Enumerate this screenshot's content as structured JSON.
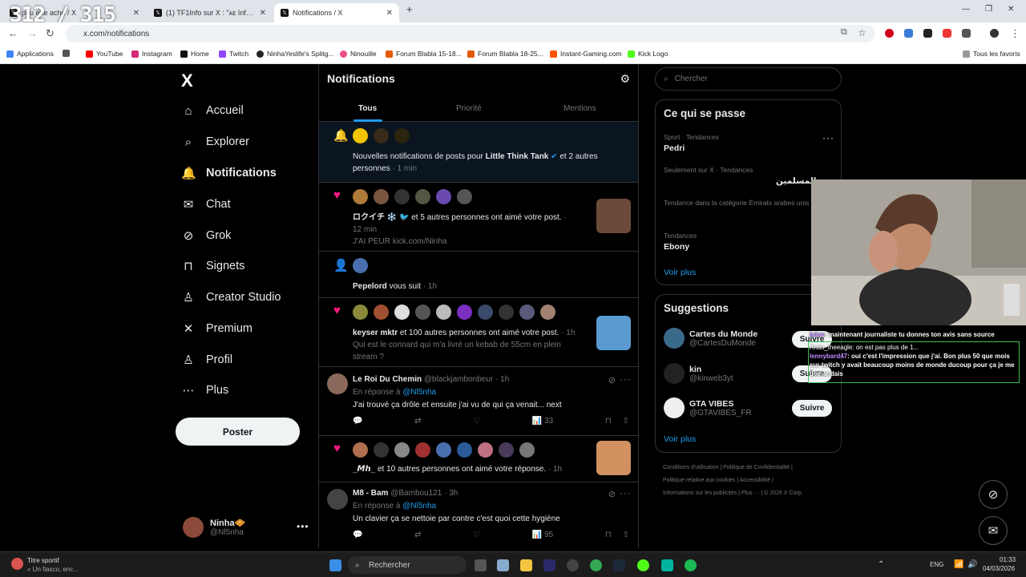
{
  "browser": {
    "tabs": [
      {
        "title": "pou     ette   ache / X"
      },
      {
        "title": "(1) TF1Info sur X : \"ᴀᴇ Influence..."
      },
      {
        "title": "Notifications / X"
      }
    ],
    "new_tab": "+",
    "url": "x.com/notifications",
    "bookmarks": [
      "Applications",
      "YouTube",
      "Instagram",
      "Home",
      "Twitch",
      "NinhaYeslife's Splitg...",
      "Ninouille",
      "Forum Blabla 15-18...",
      "Forum Blabla 18-25...",
      "Instant-Gaming.com",
      "Kick Logo"
    ],
    "all_bookmarks": "Tous les favoris"
  },
  "overlay_counter": "312 / 315",
  "sidebar": {
    "logo": "X",
    "items": [
      {
        "label": "Accueil",
        "icon": "home-icon",
        "glyph": "⌂"
      },
      {
        "label": "Explorer",
        "icon": "search-icon",
        "glyph": "⌕"
      },
      {
        "label": "Notifications",
        "icon": "bell-icon",
        "glyph": "🔔"
      },
      {
        "label": "Chat",
        "icon": "mail-icon",
        "glyph": "✉"
      },
      {
        "label": "Grok",
        "icon": "grok-icon",
        "glyph": "⊘"
      },
      {
        "label": "Signets",
        "icon": "bookmark-icon",
        "glyph": "⊓"
      },
      {
        "label": "Creator Studio",
        "icon": "flask-icon",
        "glyph": "♙"
      },
      {
        "label": "Premium",
        "icon": "x-icon",
        "glyph": "✕"
      },
      {
        "label": "Profil",
        "icon": "person-icon",
        "glyph": "♙"
      },
      {
        "label": "Plus",
        "icon": "more-circle-icon",
        "glyph": "⋯"
      }
    ],
    "post_button": "Poster",
    "user": {
      "name": "Ninha🧇",
      "handle": "@Nl5nha"
    }
  },
  "main": {
    "title": "Notifications",
    "tabs": [
      "Tous",
      "Priorité",
      "Mentions"
    ],
    "n1": {
      "pre": "Nouvelles notifications de posts pour ",
      "name": "Little Think Tank",
      "post": " et 2 autres",
      "line2": "personnes",
      "time": " · 1 min"
    },
    "n2": {
      "name": "ロクイチ ❄️ 🐦",
      "text": " et 5 autres personnes ont aimé votre post.",
      "dot": " ·",
      "time": "12 min",
      "quote": "J'AI PEUR kick.com/Ninha"
    },
    "n3": {
      "name": "Pepelord",
      "text": " vous suit",
      "time": " · 1h"
    },
    "n4": {
      "name": "keyser mktr",
      "text": " et 100 autres personnes ont aimé votre post.",
      "time": " · 1h",
      "quote1": "Qui est le connard qui m'a livré un kebab de 55cm en plein",
      "quote2": "stream ?"
    },
    "t1": {
      "name": "Le Roi Du Chemin",
      "handle": " @blackjambonbeur · 1h",
      "reply_pre": "En réponse à ",
      "reply_to": "@Nl5nha",
      "body": "J'ai trouvé ça drôle et ensuite j'ai vu de qui ça venait... next",
      "views": "33"
    },
    "n5": {
      "name": "_𝙈𝙝_",
      "text": " et 10 autres personnes ont aimé votre réponse.",
      "time": " · 1h"
    },
    "t2": {
      "name": "M8 - Bam",
      "handle": " @Bambou121 · 3h",
      "reply_pre": "En réponse à ",
      "reply_to": "@Nl5nha",
      "body": "Un clavier ça se nettoie par contre c'est quoi cette hygiène",
      "views": "95"
    }
  },
  "right": {
    "search_placeholder": "Chercher",
    "trends_title": "Ce qui se passe",
    "trends": [
      {
        "label": "Sport · Tendances",
        "value": "Pedri"
      },
      {
        "label": "Seulement sur X · Tendances",
        "value": "المسلمين"
      },
      {
        "label": "Tendance dans la catégorie Émirats arabes unis",
        "value": ""
      },
      {
        "label": "Tendances",
        "value": "Ebony"
      }
    ],
    "see_more": "Voir plus",
    "sugg_title": "Suggestions",
    "suggestions": [
      {
        "name": "Cartes du Monde",
        "handle": "@CartesDuMonde",
        "btn": "Suivre"
      },
      {
        "name": "kin",
        "handle": "@kinweb3yt",
        "btn": "Suivre"
      },
      {
        "name": "GTA VIBES",
        "handle": "@GTAVIBES_FR",
        "btn": "Suivre"
      }
    ],
    "footer1": "Conditions d'utilisation  |  Politique de Confidentialité  |",
    "footer2": "Politique relative aux cookies  |  Accessibilité  |",
    "footer3": "Informations sur les publicités  |  Plus ···  |  © 2026 X Corp."
  },
  "chat": [
    {
      "user": "kdan",
      "text": ": maintenant journaliste tu donnes ton avis sans source"
    },
    {
      "user": "Anas_theeagle",
      "text": ": on est pas plus de 1..."
    },
    {
      "user": "lennybard47",
      "text": ": oui c'est l'impression que j'ai. Bon plus 50 que mois sur twitch y avait beaucoup moins de monde ducoup pour ça je me demandais"
    }
  ],
  "taskbar": {
    "news_title": "Titre sportif",
    "news_sub": "« Un fiasco, enc...",
    "search": "Rechercher",
    "lang": "ENG",
    "time": "01:33",
    "date": "04/03/2026"
  }
}
